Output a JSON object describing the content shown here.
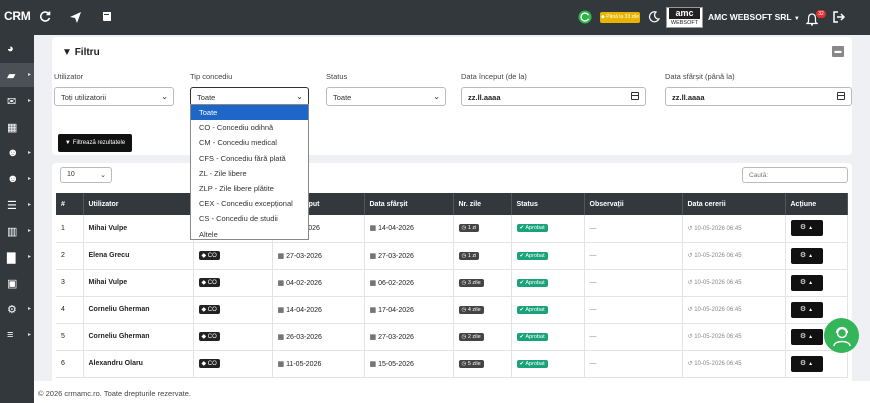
{
  "app": {
    "brand": "CRM",
    "company": "AMC WEBSOFT SRL",
    "badge_text": "Până la 33 zile",
    "notif_count": "32",
    "logo_top": "amc",
    "logo_bottom": "WEBSOFT"
  },
  "filter": {
    "title": "Filtru",
    "fields": [
      {
        "label": "Utilizator",
        "value": "Toți utilizatorii"
      },
      {
        "label": "Tip concediu",
        "value": "Toate"
      },
      {
        "label": "Status",
        "value": "Toate"
      },
      {
        "label": "Data început (de la)",
        "value": "zz.ll.aaaa"
      },
      {
        "label": "Data sfârșit (până la)",
        "value": "zz.ll.aaaa"
      }
    ],
    "submit_label": "Filtrează rezultatele"
  },
  "dropdown": {
    "options": [
      "Toate",
      "CO - Concediu odihnă",
      "CM - Concediu medical",
      "CFS - Concediu fără plată",
      "ZL - Zile libere",
      "ZLP - Zile libere plătite",
      "CEX - Concediu excepțional",
      "CS - Concediu de studii",
      "Altele"
    ]
  },
  "table": {
    "page_length": "10",
    "search_label": "Caută:",
    "headers": [
      "#",
      "Utilizator",
      "",
      "Data început",
      "Data sfârșit",
      "Nr. zile",
      "Status",
      "Observații",
      "Data cererii",
      "Acțiune"
    ],
    "rows": [
      {
        "n": "1",
        "user": "Mihai Vulpe",
        "type": "",
        "start": "...-03-2026",
        "end": "14-04-2026",
        "days": "1 zi",
        "status": "Aprobat",
        "obs": "—",
        "req": "10-05-2026 06:45"
      },
      {
        "n": "2",
        "user": "Elena Grecu",
        "type": "CO",
        "start": "27-03-2026",
        "end": "27-03-2026",
        "days": "1 zi",
        "status": "Aprobat",
        "obs": "—",
        "req": "10-05-2026 06:45"
      },
      {
        "n": "3",
        "user": "Mihai Vulpe",
        "type": "CO",
        "start": "04-02-2026",
        "end": "06-02-2026",
        "days": "3 zile",
        "status": "Aprobat",
        "obs": "—",
        "req": "10-05-2026 06:45"
      },
      {
        "n": "4",
        "user": "Corneliu Gherman",
        "type": "CO",
        "start": "14-04-2026",
        "end": "17-04-2026",
        "days": "4 zile",
        "status": "Aprobat",
        "obs": "—",
        "req": "10-05-2026 06:45"
      },
      {
        "n": "5",
        "user": "Corneliu Gherman",
        "type": "CO",
        "start": "26-03-2026",
        "end": "27-03-2026",
        "days": "2 zile",
        "status": "Aprobat",
        "obs": "—",
        "req": "10-05-2026 06:45"
      },
      {
        "n": "6",
        "user": "Alexandru Olaru",
        "type": "CO",
        "start": "11-05-2026",
        "end": "15-05-2026",
        "days": "5 zile",
        "status": "Aprobat",
        "obs": "—",
        "req": "10-05-2026 06:45"
      }
    ]
  },
  "footer": {
    "text": "© 2026 crmamc.ro. Toate drepturile rezervate."
  }
}
